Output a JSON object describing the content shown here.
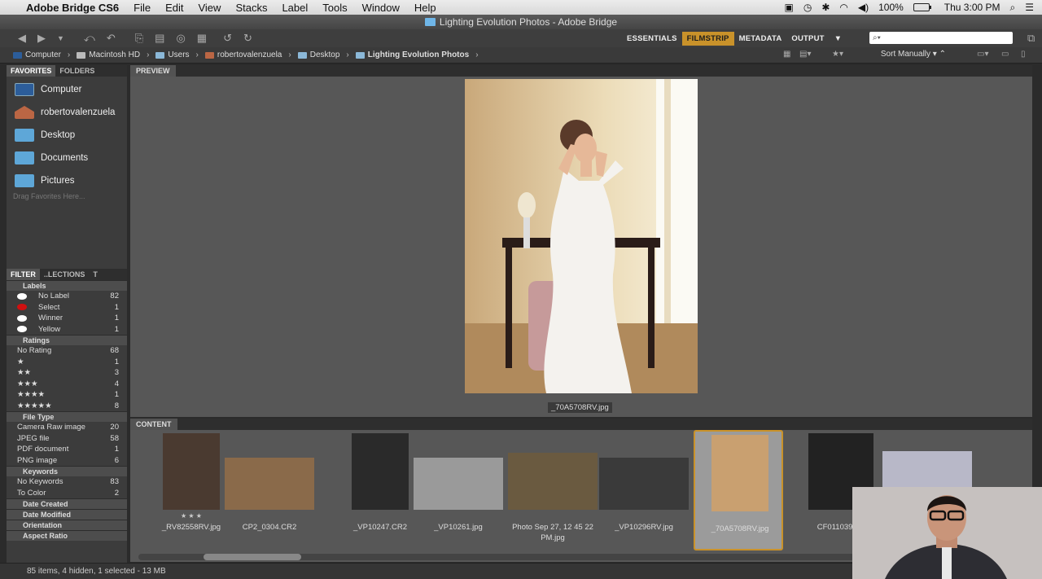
{
  "menubar": {
    "app_name": "Adobe Bridge CS6",
    "menus": [
      "File",
      "Edit",
      "View",
      "Stacks",
      "Label",
      "Tools",
      "Window",
      "Help"
    ],
    "battery": "100%",
    "clock": "Thu 3:00 PM"
  },
  "window": {
    "title": "Lighting Evolution Photos - Adobe Bridge"
  },
  "toolbar": {
    "workspaces": [
      "ESSENTIALS",
      "FILMSTRIP",
      "METADATA",
      "OUTPUT"
    ],
    "active_workspace": "FILMSTRIP",
    "search_placeholder": ""
  },
  "pathbar": {
    "crumbs": [
      "Computer",
      "Macintosh HD",
      "Users",
      "robertovalenzuela",
      "Desktop",
      "Lighting Evolution Photos"
    ],
    "sort": "Sort Manually"
  },
  "favorites": {
    "tabs": [
      "FAVORITES",
      "FOLDERS"
    ],
    "items": [
      "Computer",
      "robertovalenzuela",
      "Desktop",
      "Documents",
      "Pictures"
    ],
    "drag_hint": "Drag Favorites Here..."
  },
  "filter": {
    "tabs": [
      "FILTER",
      "..LECTIONS",
      "T"
    ],
    "sections": [
      {
        "title": "Labels",
        "rows": [
          {
            "label": "No Label",
            "count": "82",
            "color": "#ffffff"
          },
          {
            "label": "Select",
            "count": "1",
            "color": "#d01010"
          },
          {
            "label": "Winner",
            "count": "1",
            "color": "#ffffff"
          },
          {
            "label": "Yellow",
            "count": "1",
            "color": "#ffffff"
          }
        ]
      },
      {
        "title": "Ratings",
        "rows": [
          {
            "label": "No Rating",
            "count": "68"
          },
          {
            "label": "★",
            "count": "1"
          },
          {
            "label": "★★",
            "count": "3"
          },
          {
            "label": "★★★",
            "count": "4"
          },
          {
            "label": "★★★★",
            "count": "1"
          },
          {
            "label": "★★★★★",
            "count": "8"
          }
        ]
      },
      {
        "title": "File Type",
        "rows": [
          {
            "label": "Camera Raw image",
            "count": "20"
          },
          {
            "label": "JPEG file",
            "count": "58"
          },
          {
            "label": "PDF document",
            "count": "1"
          },
          {
            "label": "PNG image",
            "count": "6"
          }
        ]
      },
      {
        "title": "Keywords",
        "rows": [
          {
            "label": "No Keywords",
            "count": "83"
          },
          {
            "label": "To Color",
            "count": "2"
          }
        ]
      },
      {
        "title": "Date Created",
        "rows": []
      },
      {
        "title": "Date Modified",
        "rows": []
      },
      {
        "title": "Orientation",
        "rows": []
      },
      {
        "title": "Aspect Ratio",
        "rows": []
      }
    ]
  },
  "preview": {
    "tab": "PREVIEW",
    "caption": "_70A5708RV.jpg"
  },
  "content": {
    "tab": "CONTENT",
    "thumbnails": [
      {
        "name": "_RV82558RV.jpg",
        "stars": "★ ★ ★"
      },
      {
        "name": "CP2_0304.CR2",
        "stars": ""
      },
      {
        "name": "_VP10247.CR2",
        "stars": ""
      },
      {
        "name": "_VP10261.jpg",
        "stars": ""
      },
      {
        "name": "Photo Sep 27, 12 45 22 PM.jpg",
        "stars": ""
      },
      {
        "name": "_VP10296RV.jpg",
        "stars": ""
      },
      {
        "name": "_70A5708RV.jpg",
        "stars": "",
        "selected": true
      },
      {
        "name": "CF011039RV.",
        "stars": ""
      },
      {
        "name": "",
        "stars": ""
      }
    ]
  },
  "status": {
    "text": "85 items, 4 hidden, 1 selected - 13 MB"
  },
  "colors": {
    "accent": "#c9922a",
    "panel": "#3c3c3c",
    "canvas": "#575757"
  }
}
